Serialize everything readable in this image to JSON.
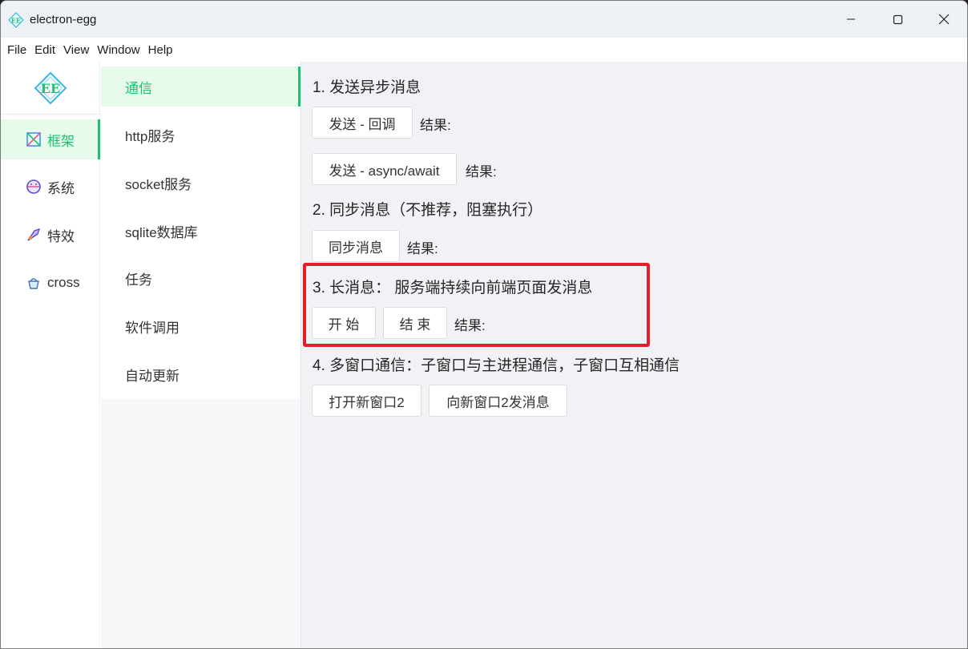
{
  "window": {
    "title": "electron-egg",
    "controls": {
      "minimize_icon": "minimize-icon",
      "maximize_icon": "maximize-icon",
      "close_icon": "close-icon"
    }
  },
  "menubar": {
    "items": [
      "File",
      "Edit",
      "View",
      "Window",
      "Help"
    ]
  },
  "sidebar_primary": {
    "logo_text": "EE",
    "items": [
      {
        "label": "框架",
        "icon": "framework-icon",
        "active": true
      },
      {
        "label": "系统",
        "icon": "system-icon",
        "active": false
      },
      {
        "label": "特效",
        "icon": "effects-icon",
        "active": false
      },
      {
        "label": "cross",
        "icon": "cross-icon",
        "active": false
      }
    ]
  },
  "sidebar_secondary": {
    "items": [
      {
        "label": "通信",
        "active": true
      },
      {
        "label": "http服务",
        "active": false
      },
      {
        "label": "socket服务",
        "active": false
      },
      {
        "label": "sqlite数据库",
        "active": false
      },
      {
        "label": "任务",
        "active": false
      },
      {
        "label": "软件调用",
        "active": false
      },
      {
        "label": "自动更新",
        "active": false
      }
    ]
  },
  "main": {
    "section1": {
      "title": "1. 发送异步消息",
      "btn_callback": "发送 - 回调",
      "result1": "结果:",
      "btn_async": "发送 - async/await",
      "result2": "结果:"
    },
    "section2": {
      "title": "2. 同步消息（不推荐，阻塞执行）",
      "btn_sync": "同步消息",
      "result": "结果:"
    },
    "section3": {
      "title": "3. 长消息： 服务端持续向前端页面发消息",
      "btn_start": "开 始",
      "btn_end": "结 束",
      "result": "结果:"
    },
    "section4": {
      "title": "4. 多窗口通信：子窗口与主进程通信，子窗口互相通信",
      "btn_open": "打开新窗口2",
      "btn_send": "向新窗口2发消息"
    }
  },
  "colors": {
    "accent": "#1dc26e",
    "accent_bg": "#e6fbec",
    "highlight": "#e3202a",
    "content_bg": "#f0f2f5"
  }
}
